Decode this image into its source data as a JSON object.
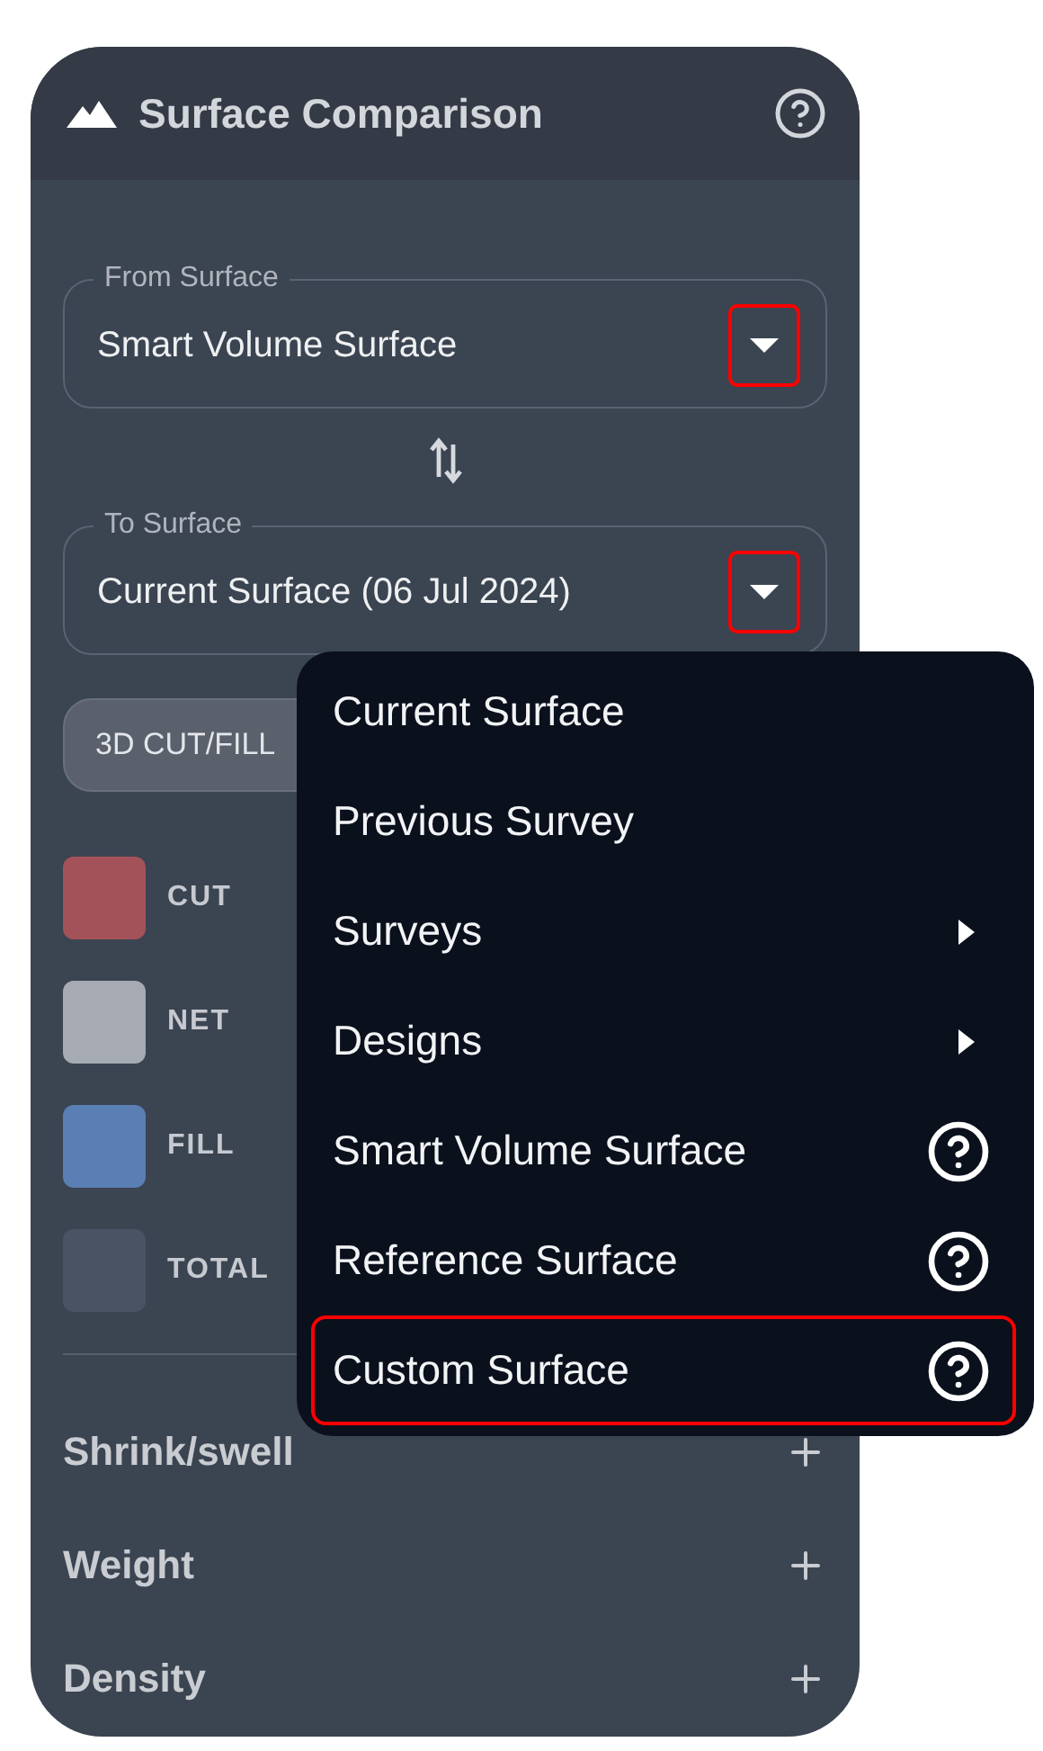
{
  "panel": {
    "title": "Surface Comparison",
    "from_field": {
      "label": "From Surface",
      "value": "Smart Volume Surface",
      "highlighted": true
    },
    "to_field": {
      "label": "To Surface",
      "value": "Current Surface (06 Jul 2024)",
      "highlighted": true
    },
    "view_button": "3D CUT/FILL",
    "legend": [
      {
        "label": "CUT",
        "color": "#a4525a"
      },
      {
        "label": "NET",
        "color": "#a6abb3"
      },
      {
        "label": "FILL",
        "color": "#5a7fb5"
      },
      {
        "label": "TOTAL",
        "color": "#4a5363"
      }
    ],
    "sections": [
      {
        "label": "Shrink/swell",
        "expanded": false
      },
      {
        "label": "Weight",
        "expanded": false
      },
      {
        "label": "Density",
        "expanded": false
      }
    ]
  },
  "menu": {
    "items": [
      {
        "label": "Current Surface",
        "kind": "plain",
        "highlighted": false
      },
      {
        "label": "Previous Survey",
        "kind": "plain",
        "highlighted": false
      },
      {
        "label": "Surveys",
        "kind": "submenu",
        "highlighted": false
      },
      {
        "label": "Designs",
        "kind": "submenu",
        "highlighted": false
      },
      {
        "label": "Smart Volume Surface",
        "kind": "help",
        "highlighted": false
      },
      {
        "label": "Reference Surface",
        "kind": "help",
        "highlighted": false
      },
      {
        "label": "Custom Surface",
        "kind": "help",
        "highlighted": true
      }
    ]
  }
}
